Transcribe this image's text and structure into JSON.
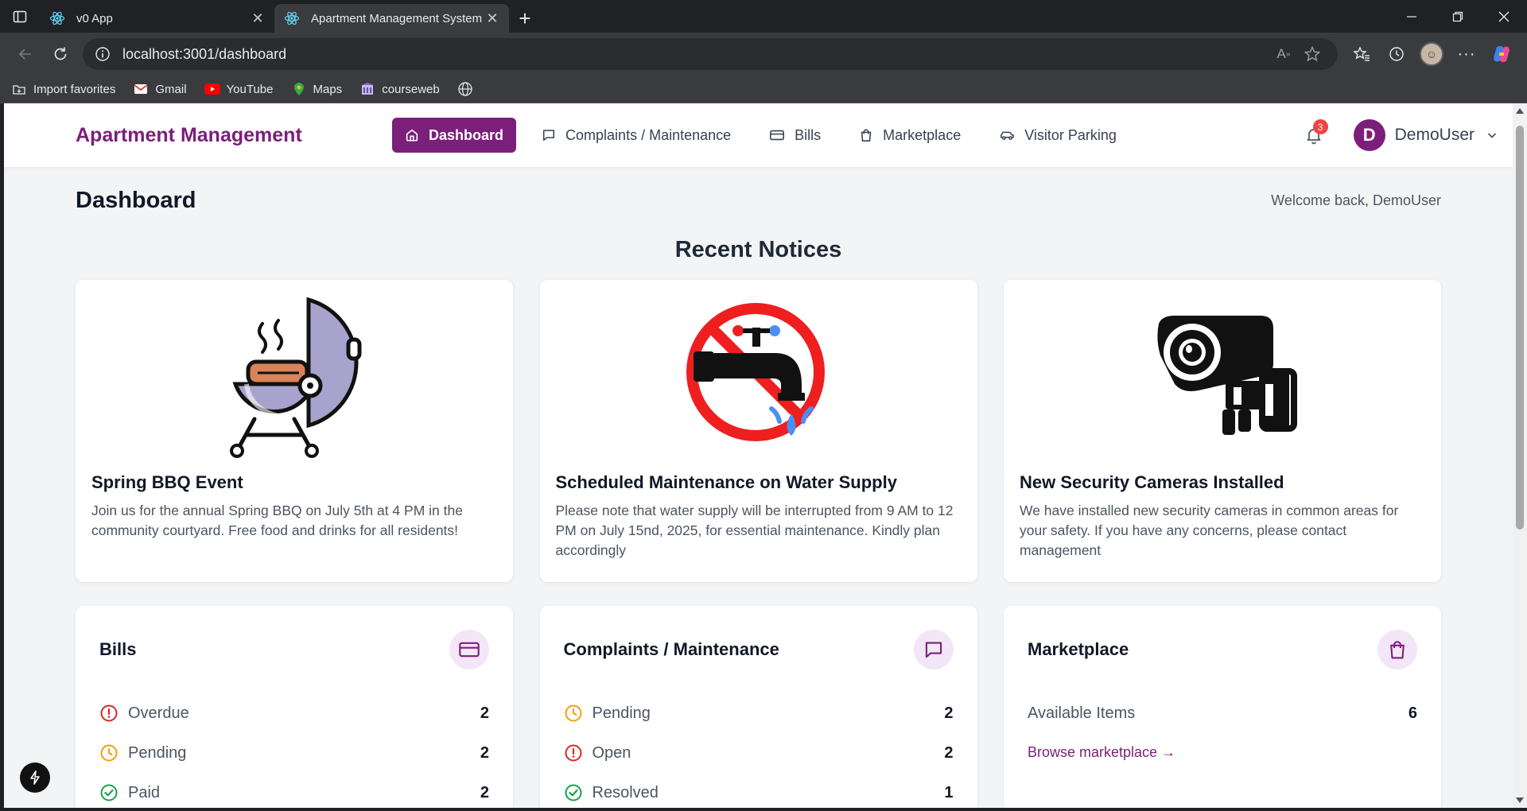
{
  "browser": {
    "tabs": [
      {
        "title": "v0 App",
        "active": false
      },
      {
        "title": "Apartment Management System",
        "active": true
      }
    ],
    "url": "localhost:3001/dashboard",
    "bookmarks": [
      {
        "label": "Import favorites",
        "icon": "import-icon"
      },
      {
        "label": "Gmail",
        "icon": "gmail-icon"
      },
      {
        "label": "YouTube",
        "icon": "youtube-icon"
      },
      {
        "label": "Maps",
        "icon": "maps-icon"
      },
      {
        "label": "courseweb",
        "icon": "courseweb-icon"
      }
    ]
  },
  "nav": {
    "brand": "Apartment Management",
    "links": [
      {
        "label": "Dashboard",
        "icon": "home-icon",
        "active": true
      },
      {
        "label": "Complaints / Maintenance",
        "icon": "message-icon",
        "active": false
      },
      {
        "label": "Bills",
        "icon": "credit-card-icon",
        "active": false
      },
      {
        "label": "Marketplace",
        "icon": "shopping-bag-icon",
        "active": false
      },
      {
        "label": "Visitor Parking",
        "icon": "car-icon",
        "active": false
      }
    ],
    "notification_count": "3",
    "user_initial": "D",
    "user_name": "DemoUser"
  },
  "page": {
    "title": "Dashboard",
    "welcome": "Welcome back, DemoUser",
    "notices_title": "Recent Notices"
  },
  "notices": [
    {
      "title": "Spring BBQ Event",
      "body": "Join us for the annual Spring BBQ on July 5th at 4 PM in the community courtyard. Free food and drinks for all residents!",
      "image": "bbq-grill-icon"
    },
    {
      "title": "Scheduled Maintenance on Water Supply",
      "body": "Please note that water supply will be interrupted from 9 AM to 12 PM on July 15nd, 2025, for essential maintenance. Kindly plan accordingly",
      "image": "no-water-tap-icon"
    },
    {
      "title": "New Security Cameras Installed",
      "body": "We have installed new security cameras in common areas for your safety. If you have any concerns, please contact management",
      "image": "security-camera-icon"
    }
  ],
  "cards": {
    "bills": {
      "title": "Bills",
      "stats": [
        {
          "label": "Overdue",
          "value": "2",
          "color": "#dc2626"
        },
        {
          "label": "Pending",
          "value": "2",
          "color": "#f59e0b"
        },
        {
          "label": "Paid",
          "value": "2",
          "color": "#16a34a"
        }
      ]
    },
    "complaints": {
      "title": "Complaints / Maintenance",
      "stats": [
        {
          "label": "Pending",
          "value": "2",
          "color": "#f59e0b"
        },
        {
          "label": "Open",
          "value": "2",
          "color": "#dc2626"
        },
        {
          "label": "Resolved",
          "value": "1",
          "color": "#16a34a"
        }
      ]
    },
    "marketplace": {
      "title": "Marketplace",
      "stats": [
        {
          "label": "Available Items",
          "value": "6"
        }
      ],
      "link": "Browse marketplace →"
    }
  },
  "colors": {
    "brand": "#7b1f7a",
    "background": "#f3f4f6"
  }
}
